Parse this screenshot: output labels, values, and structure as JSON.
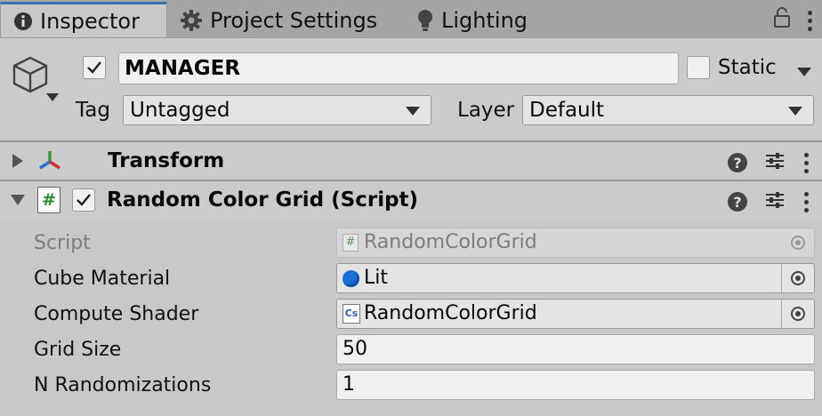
{
  "tabs": {
    "inspector": "Inspector",
    "project_settings": "Project Settings",
    "lighting": "Lighting"
  },
  "header": {
    "object_name": "MANAGER",
    "active": true,
    "static_label": "Static",
    "static_checked": false,
    "tag_label": "Tag",
    "tag_value": "Untagged",
    "layer_label": "Layer",
    "layer_value": "Default"
  },
  "components": {
    "transform": {
      "title": "Transform",
      "expanded": false,
      "icon": "transform-axes-icon"
    },
    "script": {
      "title": "Random Color Grid (Script)",
      "expanded": true,
      "enabled": true,
      "icon": "script-hash-icon"
    }
  },
  "properties": {
    "script": {
      "label": "Script",
      "value": "RandomColorGrid"
    },
    "cube_material": {
      "label": "Cube Material",
      "value": "Lit"
    },
    "compute_shader": {
      "label": "Compute Shader",
      "value": "RandomColorGrid",
      "badge": "Cs"
    },
    "grid_size": {
      "label": "Grid Size",
      "value": "50"
    },
    "n_randomizations": {
      "label": "N Randomizations",
      "value": "1"
    }
  },
  "colors": {
    "tab_accent": "#3a72b0",
    "panel_bg": "#c8c8c8",
    "material_blue": "#1a6fd6",
    "script_green": "#2e8b2e"
  }
}
